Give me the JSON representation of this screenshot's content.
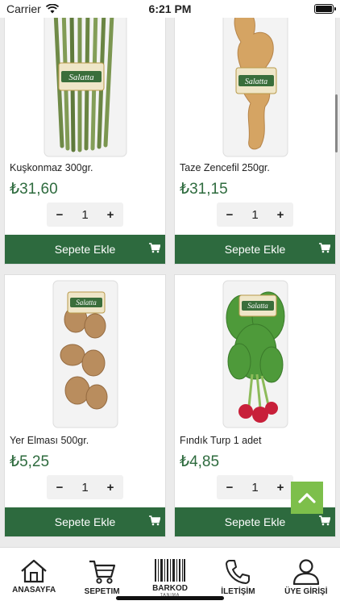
{
  "status": {
    "carrier": "Carrier",
    "time": "6:21 PM"
  },
  "products": [
    {
      "name": "Kuşkonmaz 300gr.",
      "price": "₺31,60",
      "qty": "1",
      "add_label": "Sepete Ekle",
      "brand": "Salatta",
      "image": "asparagus"
    },
    {
      "name": "Taze Zencefil 250gr.",
      "price": "₺31,15",
      "qty": "1",
      "add_label": "Sepete Ekle",
      "brand": "Salatta",
      "image": "ginger"
    },
    {
      "name": "Yer Elması 500gr.",
      "price": "₺5,25",
      "qty": "1",
      "add_label": "Sepete Ekle",
      "brand": "Salatta",
      "image": "jerusalem-artichoke"
    },
    {
      "name": "Fındık Turp 1 adet",
      "price": "₺4,85",
      "qty": "1",
      "add_label": "Sepete Ekle",
      "brand": "Salatta",
      "image": "radish"
    }
  ],
  "qty_controls": {
    "minus": "−",
    "plus": "+"
  },
  "tabs": [
    {
      "label": "ANASAYFA",
      "icon": "home-icon"
    },
    {
      "label": "SEPETIM",
      "icon": "cart-icon"
    },
    {
      "label": "BARKOD",
      "sublabel": "TANIMA",
      "icon": "barcode-icon"
    },
    {
      "label": "İLETİŞİM",
      "icon": "phone-icon"
    },
    {
      "label": "ÜYE GİRİŞİ",
      "icon": "user-icon"
    }
  ],
  "colors": {
    "accent": "#2d6a3e",
    "price": "#2e6b3e",
    "scroll_top": "#7dbf4b"
  }
}
